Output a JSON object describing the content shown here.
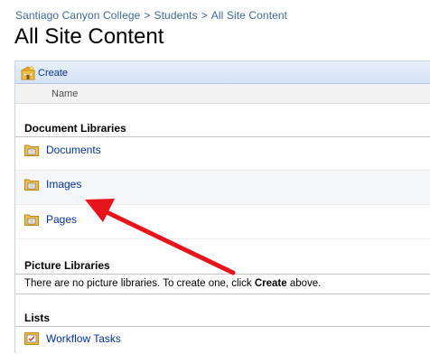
{
  "breadcrumb": {
    "items": [
      "Santiago Canyon College",
      "Students",
      "All Site Content"
    ],
    "separator": ">"
  },
  "page_title": "All Site Content",
  "toolbar": {
    "create_label": "Create",
    "create_icon": "create-site-icon"
  },
  "column_header": {
    "name_label": "Name"
  },
  "sections": {
    "document_libraries": {
      "title": "Document Libraries",
      "items": [
        {
          "label": "Documents",
          "icon": "document-library-icon"
        },
        {
          "label": "Images",
          "icon": "document-library-icon"
        },
        {
          "label": "Pages",
          "icon": "document-library-icon"
        }
      ]
    },
    "picture_libraries": {
      "title": "Picture Libraries",
      "message_prefix": "There are no picture libraries. To create one, click ",
      "message_link": "Create",
      "message_suffix": " above."
    },
    "lists": {
      "title": "Lists",
      "items": [
        {
          "label": "Workflow Tasks",
          "icon": "task-list-icon"
        }
      ]
    }
  },
  "colors": {
    "link": "#003399",
    "breadcrumb": "#3d6a97",
    "toolbar_bg": "#dbe6f7",
    "annotation_arrow": "#e8141b",
    "folder_icon": "#e8b43a"
  }
}
